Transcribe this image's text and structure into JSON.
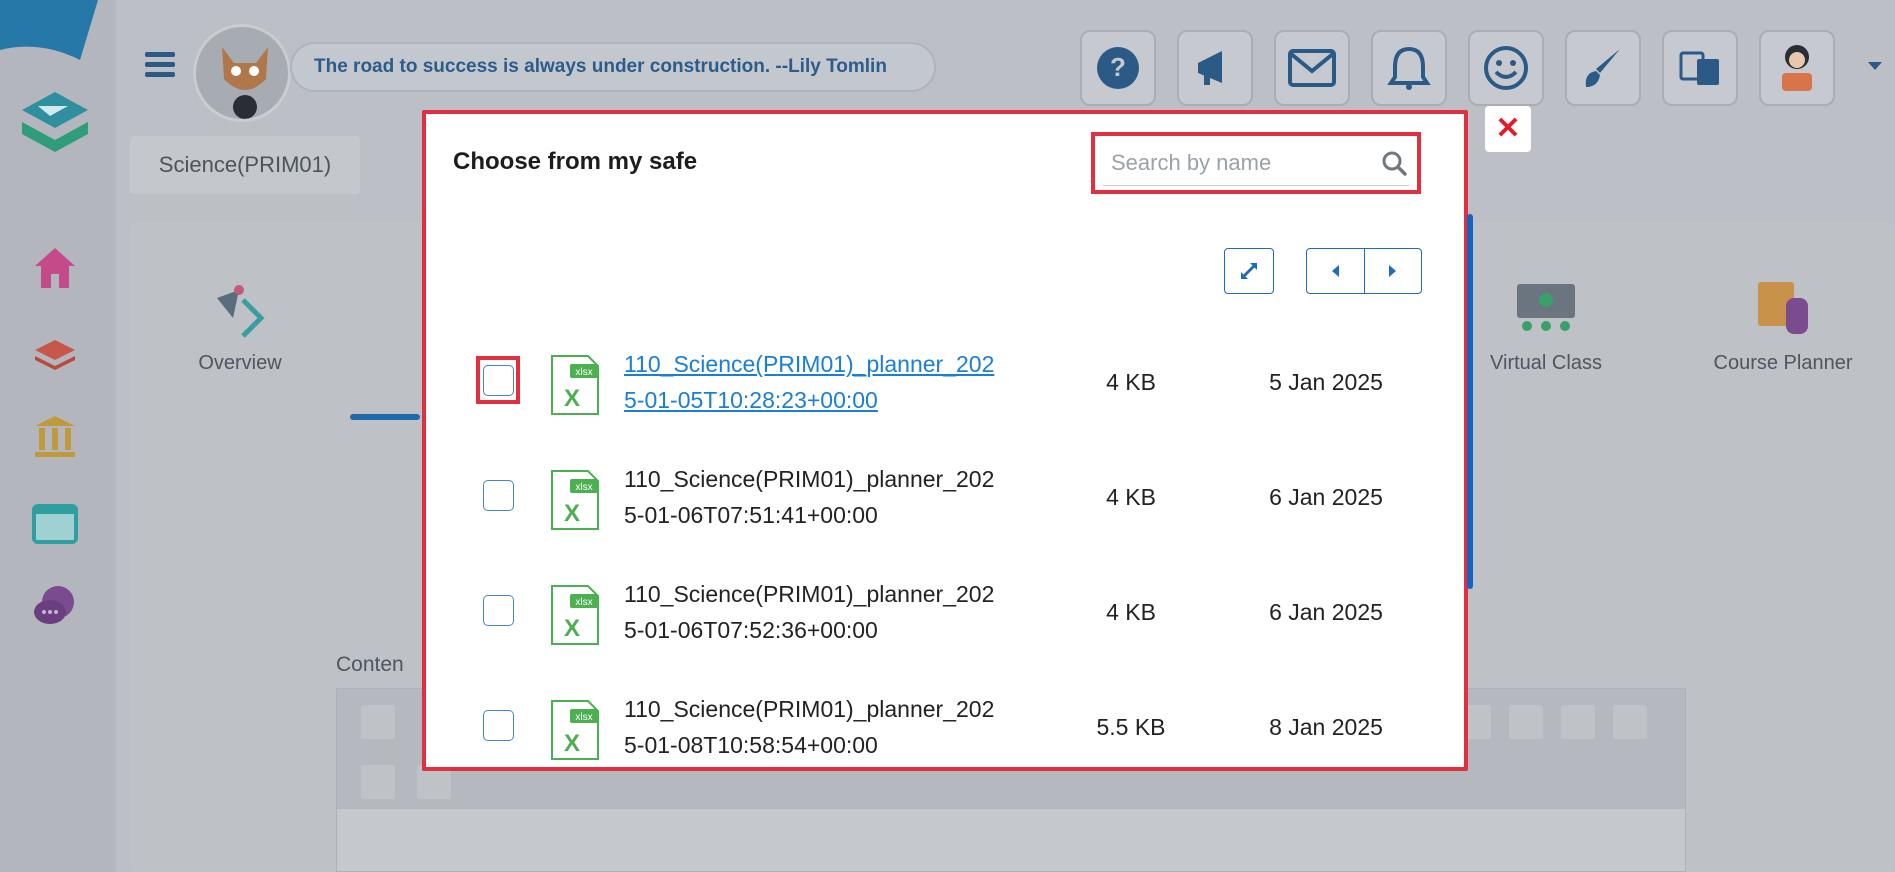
{
  "background": {
    "quote": "The road to success is always under construction. --Lily Tomlin",
    "course_chip": "Science(PRIM01)",
    "tabs": [
      {
        "label": "Overview"
      },
      {
        "label": "Virtual Class"
      },
      {
        "label": "Course Planner"
      }
    ],
    "content_label": "Conten",
    "top_icons": [
      "help-icon",
      "megaphone-icon",
      "mail-icon",
      "bell-icon",
      "smiley-icon",
      "brush-icon",
      "translate-icon",
      "user-avatar-icon"
    ]
  },
  "modal": {
    "title": "Choose from my safe",
    "search": {
      "placeholder": "Search by name",
      "value": ""
    },
    "files": [
      {
        "name": "110_Science(PRIM01)_planner_2025-01-05T10:28:23+00:00",
        "size": "4 KB",
        "date": "5 Jan 2025",
        "type": "xlsx",
        "checked": false,
        "link": true
      },
      {
        "name": "110_Science(PRIM01)_planner_2025-01-06T07:51:41+00:00",
        "size": "4 KB",
        "date": "6 Jan 2025",
        "type": "xlsx",
        "checked": false,
        "link": false
      },
      {
        "name": "110_Science(PRIM01)_planner_2025-01-06T07:52:36+00:00",
        "size": "4 KB",
        "date": "6 Jan 2025",
        "type": "xlsx",
        "checked": false,
        "link": false
      },
      {
        "name": "110_Science(PRIM01)_planner_2025-01-08T10:58:54+00:00",
        "size": "5.5 KB",
        "date": "8 Jan 2025",
        "type": "xlsx",
        "checked": false,
        "link": false
      }
    ],
    "close_symbol": "✕"
  },
  "colors": {
    "highlight": "#e0303f",
    "accent": "#1e6bb8",
    "excel_green": "#4caf50",
    "close_red": "#e01d2d"
  }
}
